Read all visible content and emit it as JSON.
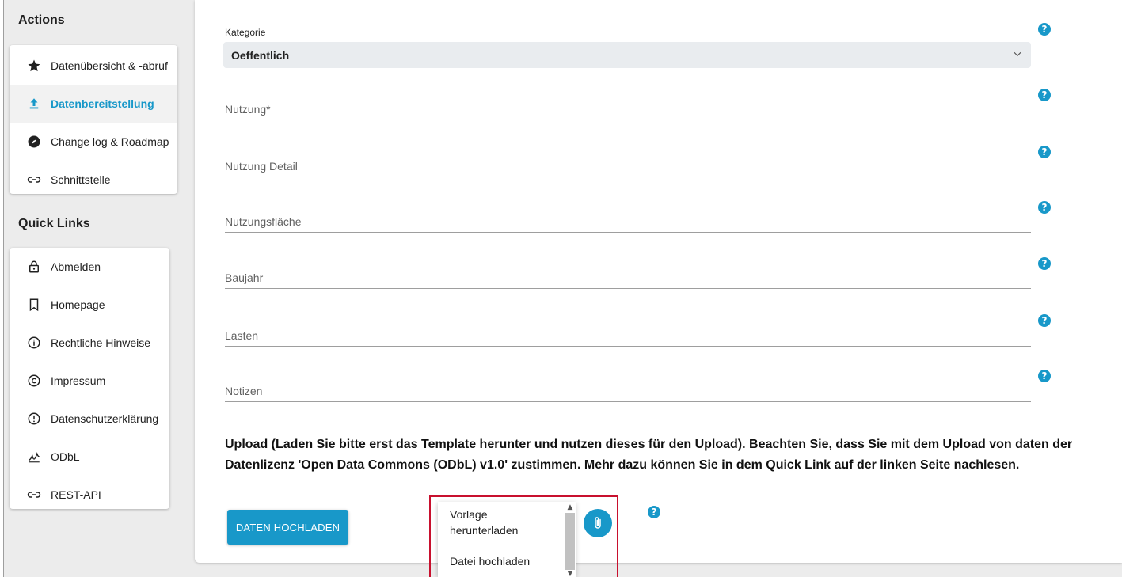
{
  "sidebar": {
    "actions_title": "Actions",
    "actions": [
      {
        "label": "Datenübersicht & -abruf",
        "icon": "star-icon"
      },
      {
        "label": "Datenbereitstellung",
        "icon": "upload-icon",
        "active": true
      },
      {
        "label": "Change log & Roadmap",
        "icon": "compass-icon"
      },
      {
        "label": "Schnittstelle",
        "icon": "link-icon"
      }
    ],
    "quicklinks_title": "Quick Links",
    "quicklinks": [
      {
        "label": "Abmelden",
        "icon": "lock-icon"
      },
      {
        "label": "Homepage",
        "icon": "bookmark-icon"
      },
      {
        "label": "Rechtliche Hinweise",
        "icon": "info-icon"
      },
      {
        "label": "Impressum",
        "icon": "copyright-icon"
      },
      {
        "label": "Datenschutzerklärung",
        "icon": "alert-icon"
      },
      {
        "label": "ODbL",
        "icon": "signature-icon"
      },
      {
        "label": "REST-API",
        "icon": "link-icon"
      }
    ]
  },
  "form": {
    "kategorie_label": "Kategorie",
    "kategorie_value": "Oeffentlich",
    "fields": [
      "Nutzung*",
      "Nutzung Detail",
      "Nutzungsfläche",
      "Baujahr",
      "Lasten",
      "Notizen"
    ],
    "help_glyph": "?"
  },
  "upload": {
    "text": "Upload (Laden Sie bitte erst das Template herunter und nutzen dieses für den Upload). Beachten Sie, dass Sie mit dem Upload von daten der Datenlizenz 'Open Data Commons (ODbL) v1.0' zustimmen. Mehr dazu können Sie in dem Quick Link auf der linken Seite nachlesen.",
    "button_label": "DATEN HOCHLADEN",
    "menu": [
      "Vorlage herunterladen",
      "Datei hochladen"
    ]
  },
  "colors": {
    "accent": "#1898c9",
    "highlight": "#c8102e"
  }
}
